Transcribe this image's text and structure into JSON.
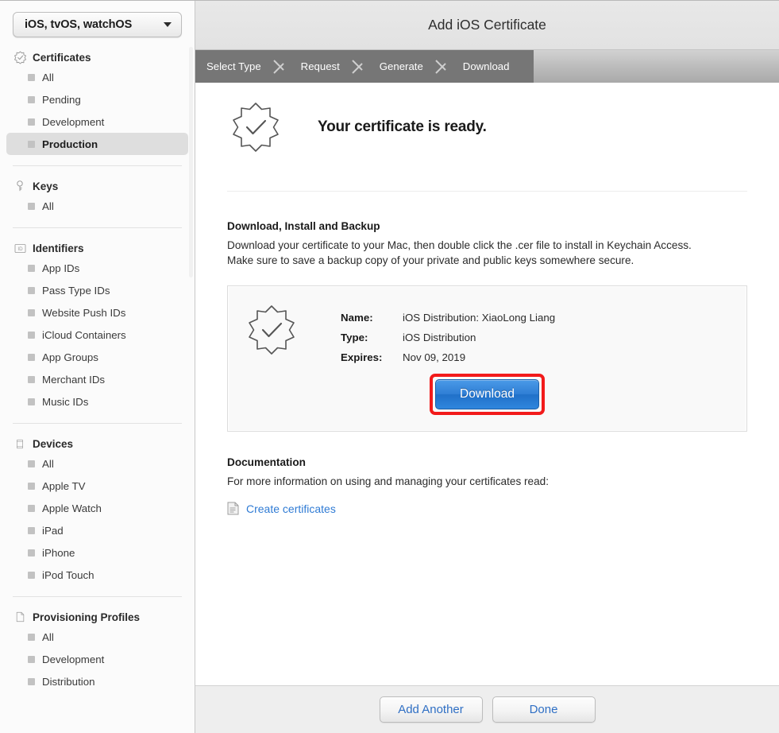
{
  "sidebar": {
    "platform_select": {
      "value": "iOS, tvOS, watchOS",
      "caret_icon": "chevron-down-icon"
    },
    "sections": [
      {
        "title": "Certificates",
        "icon": "certificate-seal-icon",
        "items": [
          {
            "label": "All",
            "selected": false
          },
          {
            "label": "Pending",
            "selected": false
          },
          {
            "label": "Development",
            "selected": false
          },
          {
            "label": "Production",
            "selected": true
          }
        ]
      },
      {
        "title": "Keys",
        "icon": "key-icon",
        "items": [
          {
            "label": "All",
            "selected": false
          }
        ]
      },
      {
        "title": "Identifiers",
        "icon": "id-badge-icon",
        "items": [
          {
            "label": "App IDs",
            "selected": false
          },
          {
            "label": "Pass Type IDs",
            "selected": false
          },
          {
            "label": "Website Push IDs",
            "selected": false
          },
          {
            "label": "iCloud Containers",
            "selected": false
          },
          {
            "label": "App Groups",
            "selected": false
          },
          {
            "label": "Merchant IDs",
            "selected": false
          },
          {
            "label": "Music IDs",
            "selected": false
          }
        ]
      },
      {
        "title": "Devices",
        "icon": "device-phone-icon",
        "items": [
          {
            "label": "All",
            "selected": false
          },
          {
            "label": "Apple TV",
            "selected": false
          },
          {
            "label": "Apple Watch",
            "selected": false
          },
          {
            "label": "iPad",
            "selected": false
          },
          {
            "label": "iPhone",
            "selected": false
          },
          {
            "label": "iPod Touch",
            "selected": false
          }
        ]
      },
      {
        "title": "Provisioning Profiles",
        "icon": "document-icon",
        "items": [
          {
            "label": "All",
            "selected": false
          },
          {
            "label": "Development",
            "selected": false
          },
          {
            "label": "Distribution",
            "selected": false
          }
        ]
      }
    ]
  },
  "header": {
    "title": "Add iOS Certificate"
  },
  "steps": {
    "items": [
      "Select Type",
      "Request",
      "Generate",
      "Download"
    ],
    "current": "Download"
  },
  "main": {
    "ready": {
      "icon": "certificate-seal-icon",
      "heading": "Your certificate is ready."
    },
    "download_section": {
      "heading": "Download, Install and Backup",
      "line1": "Download your certificate to your Mac, then double click the .cer file to install in Keychain Access.",
      "line2": "Make sure to save a backup copy of your private and public keys somewhere secure."
    },
    "certificate": {
      "icon": "certificate-seal-icon",
      "fields": [
        {
          "key": "Name:",
          "value": "iOS Distribution: XiaoLong Liang"
        },
        {
          "key": "Type:",
          "value": "iOS Distribution"
        },
        {
          "key": "Expires:",
          "value": "Nov 09, 2019"
        }
      ],
      "download_button": "Download",
      "highlight_color": "#f21b1b",
      "button_color": "#2f7ed4"
    },
    "documentation": {
      "heading": "Documentation",
      "line1": "For more information on using and managing your certificates read:",
      "link_icon": "document-icon",
      "link_text": "Create certificates",
      "link_color": "#2f7bd4"
    }
  },
  "footer": {
    "add_another_label": "Add Another",
    "done_label": "Done"
  }
}
